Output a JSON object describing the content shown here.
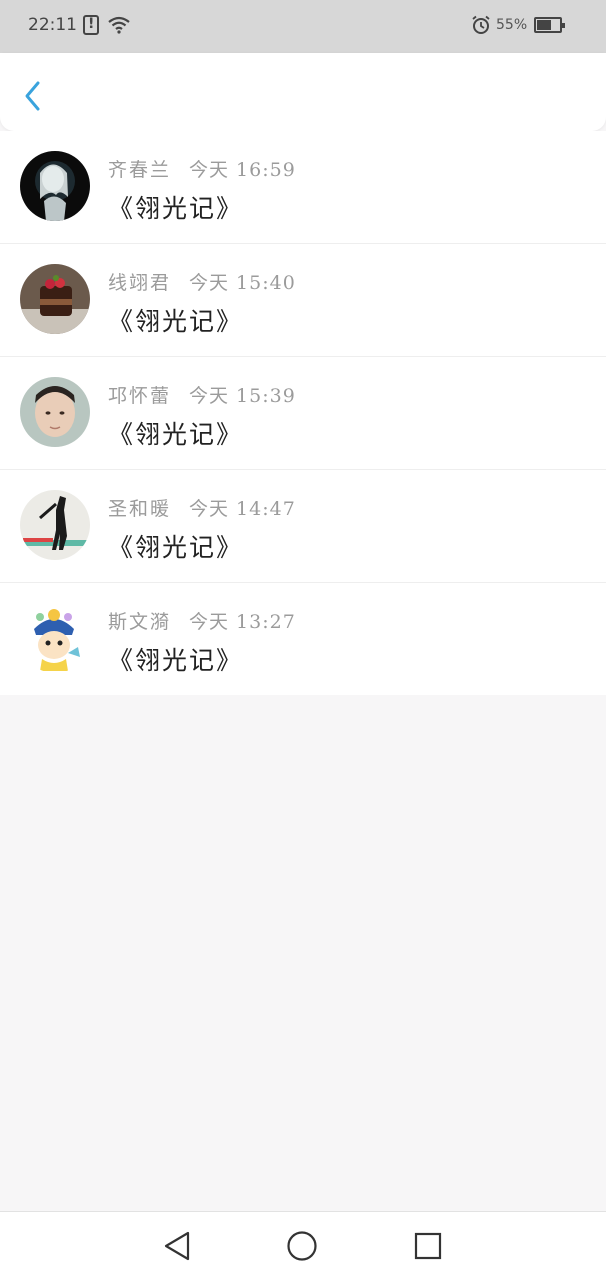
{
  "status_bar": {
    "time": "22:11",
    "battery": "55%",
    "icons": [
      "alert-icon",
      "wifi-icon",
      "alarm-icon",
      "battery-icon"
    ]
  },
  "header": {
    "back_icon": "chevron-left-icon",
    "accent_color": "#3aa3dd"
  },
  "messages": [
    {
      "name": "齐春兰",
      "time": "今天 16:59",
      "title": "《翎光记》",
      "avatar": "avatar-girl-dark"
    },
    {
      "name": "线翊君",
      "time": "今天 15:40",
      "title": "《翎光记》",
      "avatar": "avatar-dessert"
    },
    {
      "name": "邛怀蕾",
      "time": "今天 15:39",
      "title": "《翎光记》",
      "avatar": "avatar-face"
    },
    {
      "name": "圣和暖",
      "time": "今天 14:47",
      "title": "《翎光记》",
      "avatar": "avatar-silhouette"
    },
    {
      "name": "斯文漪",
      "time": "今天 13:27",
      "title": "《翎光记》",
      "avatar": "avatar-cartoon"
    }
  ],
  "nav_bar": {
    "icons": [
      "back-triangle-icon",
      "home-circle-icon",
      "recent-square-icon"
    ]
  }
}
